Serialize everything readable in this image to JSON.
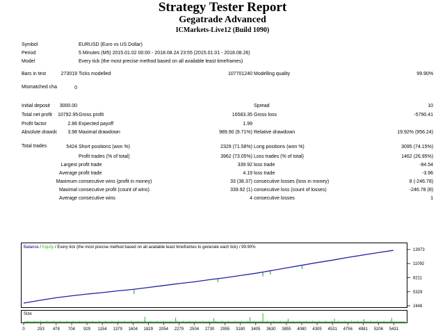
{
  "header": {
    "title": "Strategy Tester Report",
    "subtitle": "Gegatrade Advanced",
    "server": "ICMarkets-Live12 (Build 1090)"
  },
  "info": {
    "symbol_label": "Symbol",
    "symbol_value": "EURUSD (Euro vs US Dollar)",
    "period_label": "Period",
    "period_value": "5 Minutes (M5) 2015.01.02 00:00 - 2018.08.24 23:55 (2015.01.01 - 2018.08.26)",
    "model_label": "Model",
    "model_value": "Every tick (the most precise method based on all available least timeframes)"
  },
  "stats": {
    "bars_label": "Bars in test",
    "bars_value": "273019",
    "ticks_label": "Ticks modelled",
    "ticks_value": "107701240",
    "mq_label": "Modelling quality",
    "mq_value": "99.90%",
    "mce_label": "Mismatched charts errors",
    "mce_value": "0",
    "deposit_label": "Initial deposit",
    "deposit_value": "3000.00",
    "spread_label": "Spread",
    "spread_value": "10",
    "tnp_label": "Total net profit",
    "tnp_value": "10792.95",
    "gp_label": "Gross profit",
    "gp_value": "16583.35",
    "gl_label": "Gross loss",
    "gl_value": "-5790.41",
    "pf_label": "Profit factor",
    "pf_value": "2.86",
    "ep_label": "Expected payoff",
    "ep_value": "1.99",
    "ad_label": "Absolute drawdown",
    "ad_value": "3.98",
    "md_label": "Maximal drawdown",
    "md_value": "989.90 (9.71%)",
    "rd_label": "Relative drawdown",
    "rd_value": "19.92% (956.24)",
    "tt_label": "Total trades",
    "tt_value": "5424",
    "sp_label": "Short positions (won %)",
    "sp_value": "2329 (71.58%)",
    "lp_label": "Long positions (won %)",
    "lp_value": "3095 (74.15%)",
    "pt_label": "Profit trades (% of total)",
    "pt_value": "3962 (73.05%)",
    "lt_label": "Loss trades (% of total)",
    "lt_value": "1462 (26.95%)",
    "largest": "Largest",
    "average": "Average",
    "maximum": "Maximum",
    "maximal": "Maximal",
    "lpt_label": "profit trade",
    "lpt_value": "339.92",
    "llt_label": "loss trade",
    "llt_value": "-84.54",
    "apt_label": "profit trade",
    "apt_value": "4.19",
    "alt_label": "loss trade",
    "alt_value": "-3.96",
    "mcw_label": "consecutive wins (profit in money)",
    "mcw_value": "33 (38.37)",
    "mcl_label": "consecutive losses (loss in money)",
    "mcl_value": "8 (-246.78)",
    "mcp_label": "consecutive profit (count of wins)",
    "mcp_value": "339.92 (1)",
    "mcll_label": "consecutive loss (count of losses)",
    "mcll_value": "-246.78 (8)",
    "acw_label": "consecutive wins",
    "acw_value": "4",
    "acl_label": "consecutive losses",
    "acl_value": "1"
  },
  "colors": {
    "balance": "#1f1fa8",
    "equity": "#2fb52f",
    "legend_text": "#000080",
    "size_bars": "#2fb52f"
  },
  "chart_data": {
    "type": "line",
    "legend": {
      "balance": "Balance",
      "sep": " / ",
      "equity": "Equity",
      "rest": " / Every tick (the most precise method based on all available least timeframes to generate each tick) / 99.90%"
    },
    "y_ticks": [
      13973,
      11092,
      8211,
      5329,
      2448
    ],
    "ylim": [
      2448,
      13973
    ],
    "x_ticks": [
      0,
      253,
      478,
      704,
      929,
      1154,
      1379,
      1604,
      1829,
      2054,
      2279,
      2504,
      2730,
      2955,
      3180,
      3405,
      3630,
      3855,
      4080,
      4305,
      4531,
      4756,
      4981,
      5206,
      5431
    ],
    "xlim": [
      0,
      5600
    ],
    "balance": {
      "x": [
        0,
        253,
        478,
        704,
        929,
        1154,
        1379,
        1604,
        1829,
        2054,
        2279,
        2504,
        2730,
        2955,
        3180,
        3405,
        3630,
        3855,
        4080,
        4305,
        4531,
        4756,
        4981,
        5206,
        5424
      ],
      "y": [
        3000,
        3600,
        4100,
        4500,
        4850,
        5150,
        5500,
        5800,
        6200,
        6600,
        7000,
        7350,
        7800,
        8200,
        8650,
        9100,
        9650,
        10200,
        10750,
        11300,
        11800,
        12350,
        12850,
        13350,
        13800
      ]
    },
    "equity_dips": [
      {
        "x": 1620,
        "y": 5300
      },
      {
        "x": 2850,
        "y": 7700
      },
      {
        "x": 3510,
        "y": 8900
      },
      {
        "x": 3620,
        "y": 9300
      },
      {
        "x": 4085,
        "y": 10400
      }
    ],
    "size_panel_label": "Size",
    "size_spikes": [
      {
        "x": 1780,
        "v": 0.55
      },
      {
        "x": 2230,
        "v": 0.45
      },
      {
        "x": 2790,
        "v": 0.4
      },
      {
        "x": 3320,
        "v": 0.5
      },
      {
        "x": 3510,
        "v": 0.95
      },
      {
        "x": 3880,
        "v": 0.35
      },
      {
        "x": 4560,
        "v": 0.35
      },
      {
        "x": 4990,
        "v": 0.3
      },
      {
        "x": 5400,
        "v": 0.45
      }
    ]
  }
}
